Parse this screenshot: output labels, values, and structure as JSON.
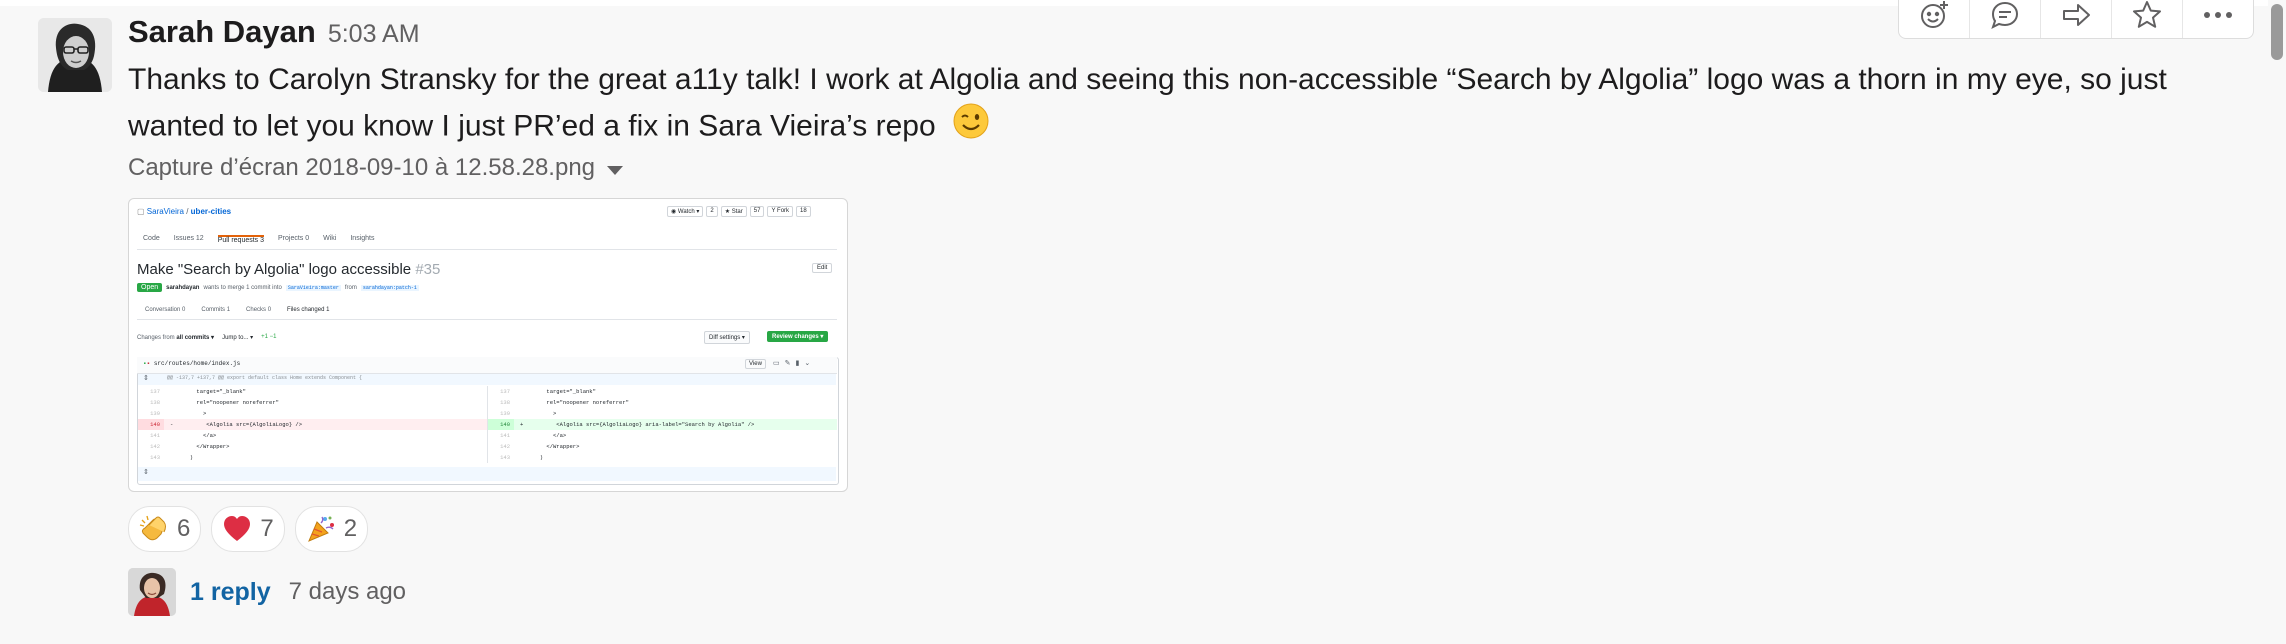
{
  "message": {
    "author": "Sarah Dayan",
    "time": "5:03 AM",
    "text": "Thanks to Carolyn Stransky for the great a11y talk! I work at Algolia and seeing this non-accessible “Search by Algolia” logo was a thorn in my eye, so just wanted to let you know I just PR’ed a fix in Sara Vieira’s repo",
    "text_emoji": "winking-face"
  },
  "attachment": {
    "filename": "Capture d’écran 2018-09-10 à 12.58.28.png",
    "preview": {
      "repo_owner": "SaraVieira",
      "repo_sep": " / ",
      "repo_name": "uber-cities",
      "watch": "Watch ▾",
      "watch_count": "2",
      "star": "Star",
      "star_count": "57",
      "fork": "Fork",
      "fork_count": "18",
      "tabs": [
        "Code",
        "Issues 12",
        "Pull requests 3",
        "Projects 0",
        "Wiki",
        "Insights"
      ],
      "pr_title": "Make \"Search by Algolia\" logo accessible",
      "pr_number": "#35",
      "edit": "Edit",
      "open_badge": "Open",
      "merge_text_1": "sarahdayan",
      "merge_text_2": "wants to merge 1 commit into",
      "base_branch": "SaraVieira:master",
      "merge_from": "from",
      "head_branch": "sarahdayan:patch-1",
      "subtabs": [
        "Conversation 0",
        "Commits 1",
        "Checks 0",
        "Files changed 1"
      ],
      "changes_from": "Changes from",
      "all_commits": "all commits ▾",
      "jump_to": "Jump to... ▾",
      "diffstat": "+1 −1",
      "diff_settings": "Diff settings ▾",
      "review_changes": "Review changes ▾",
      "file_path": "src/routes/home/index.js",
      "view": "View",
      "hunk_header": "@@ -137,7 +137,7 @@ export default class Home extends Component {",
      "left_lines": [
        {
          "num": "137",
          "code": "        target=\"_blank\"",
          "type": "ctx"
        },
        {
          "num": "138",
          "code": "        rel=\"noopener noreferrer\"",
          "type": "ctx"
        },
        {
          "num": "139",
          "code": "          >",
          "type": "ctx"
        },
        {
          "num": "140",
          "code": "-          <Algolia src={AlgoliaLogo} />",
          "type": "del"
        },
        {
          "num": "141",
          "code": "          </a>",
          "type": "ctx"
        },
        {
          "num": "142",
          "code": "        </Wrapper>",
          "type": "ctx"
        },
        {
          "num": "143",
          "code": "      )",
          "type": "ctx"
        }
      ],
      "right_lines": [
        {
          "num": "137",
          "code": "        target=\"_blank\"",
          "type": "ctx"
        },
        {
          "num": "138",
          "code": "        rel=\"noopener noreferrer\"",
          "type": "ctx"
        },
        {
          "num": "139",
          "code": "          >",
          "type": "ctx"
        },
        {
          "num": "140",
          "code": "+          <Algolia src={AlgoliaLogo} aria-label=\"Search by Algolia\" />",
          "type": "add"
        },
        {
          "num": "141",
          "code": "          </a>",
          "type": "ctx"
        },
        {
          "num": "142",
          "code": "        </Wrapper>",
          "type": "ctx"
        },
        {
          "num": "143",
          "code": "      )",
          "type": "ctx"
        }
      ]
    }
  },
  "reactions": [
    {
      "emoji": "clapping-hands",
      "count": "6"
    },
    {
      "emoji": "red-heart",
      "count": "7"
    },
    {
      "emoji": "party-popper",
      "count": "2"
    }
  ],
  "thread": {
    "reply_label": "1 reply",
    "reply_time": "7 days ago"
  },
  "actions": [
    "add-reaction",
    "start-thread",
    "share-message",
    "save-message",
    "more-actions"
  ],
  "colors": {
    "link": "#1264a3",
    "github_link": "#0366d6",
    "github_green": "#28a745",
    "diff_del": "#ffeef0",
    "diff_add": "#e6ffed"
  }
}
